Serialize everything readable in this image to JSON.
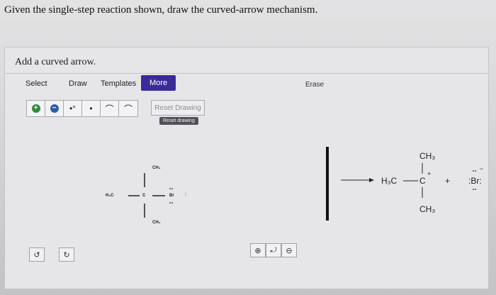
{
  "question": "Given the single-step reaction shown, draw the curved-arrow mechanism.",
  "prompt": "Add a curved arrow.",
  "tabs": {
    "select": "Select",
    "draw": "Draw",
    "templates": "Templates",
    "more": "More",
    "erase": "Erase"
  },
  "tools": {
    "plus": "+",
    "minus": "−",
    "radical_pair": "•°",
    "radical": "•",
    "full_arrow": "⌒",
    "half_arrow": "⌒"
  },
  "reset": {
    "label": "Reset Drawing",
    "tooltip": "Reset drawing"
  },
  "reactant": {
    "top": "CH₃",
    "left": "H₃C",
    "center": "C",
    "right": "Br",
    "bottom": "CH₃",
    "lone_pair_dots": ":"
  },
  "product": {
    "top": "CH₃",
    "left": "H₃C",
    "center": "C",
    "charge": "+",
    "bottom": "CH₃",
    "plus": "+",
    "bromide": ":Br:",
    "bromide_charge": "−"
  },
  "bottom": {
    "undo": "↺",
    "redo": "↻",
    "zoom_in": "⊕",
    "zoom_reset": "⤾",
    "zoom_out": "⊖"
  }
}
